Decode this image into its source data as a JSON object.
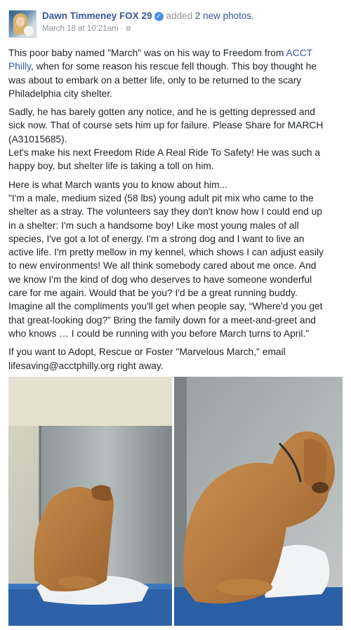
{
  "post": {
    "author": "Dawn Timmeney FOX 29",
    "action_text": "added",
    "action_link": "2 new photos.",
    "timestamp": "March 18 at 10:21am",
    "verified_icon": "check-badge-icon",
    "privacy_icon": "globe-icon",
    "paragraphs": [
      [
        "This poor baby named \"March\" was on his way to Freedom from |LINK|",
        "Philly|/LINK|, when for some reason his rescue fell though. This boy thought he",
        "was about to embark on a better life, only to be returned to the scary",
        "Philadelphia city shelter."
      ],
      [
        "Sadly, he has barely gotten any notice, and he is getting depressed and",
        "sick now. That of course sets him up for failure. Please Share for MARCH",
        "(A31015685).",
        "Let's make his next Freedom Ride A Real Ride To Safety! He was such a",
        "happy boy, but shelter life is taking a toll on him."
      ],
      [
        "Here is what March wants you to know about him...",
        "\"I'm a male, medium sized (58 lbs) young adult pit mix who came to the",
        "shelter as a stray. The volunteers say they don't know how I could end up",
        "in a shelter: I'm such a handsome boy! Like most young males of all",
        "species, I've got a lot of energy. I'm a strong dog and I want to live an",
        "active life. I'm pretty mellow in my kennel, which shows I can adjust easily",
        "to new environments! We all think somebody cared about me once. And",
        "we know I'm the kind of dog who deserves to have someone wonderful",
        "care for me again. Would that be you? I'd be a great running buddy.",
        "Imagine all the compliments you'll get when people say, “Where'd you get",
        "that great-looking dog?” Bring the family down for a meet-and-greet and",
        "who knows … I could be running with you before March turns to April.\""
      ],
      [
        "If you want to Adopt, Rescue or Foster \"Marvelous March,\" email",
        "lifesaving@acctphilly.org right away."
      ]
    ],
    "link_text_1": "ACCT",
    "link_text_2": "Philly",
    "colors": {
      "link": "#365899",
      "meta": "#90949c",
      "text": "#1d2129",
      "verified": "#4a90e2"
    }
  }
}
